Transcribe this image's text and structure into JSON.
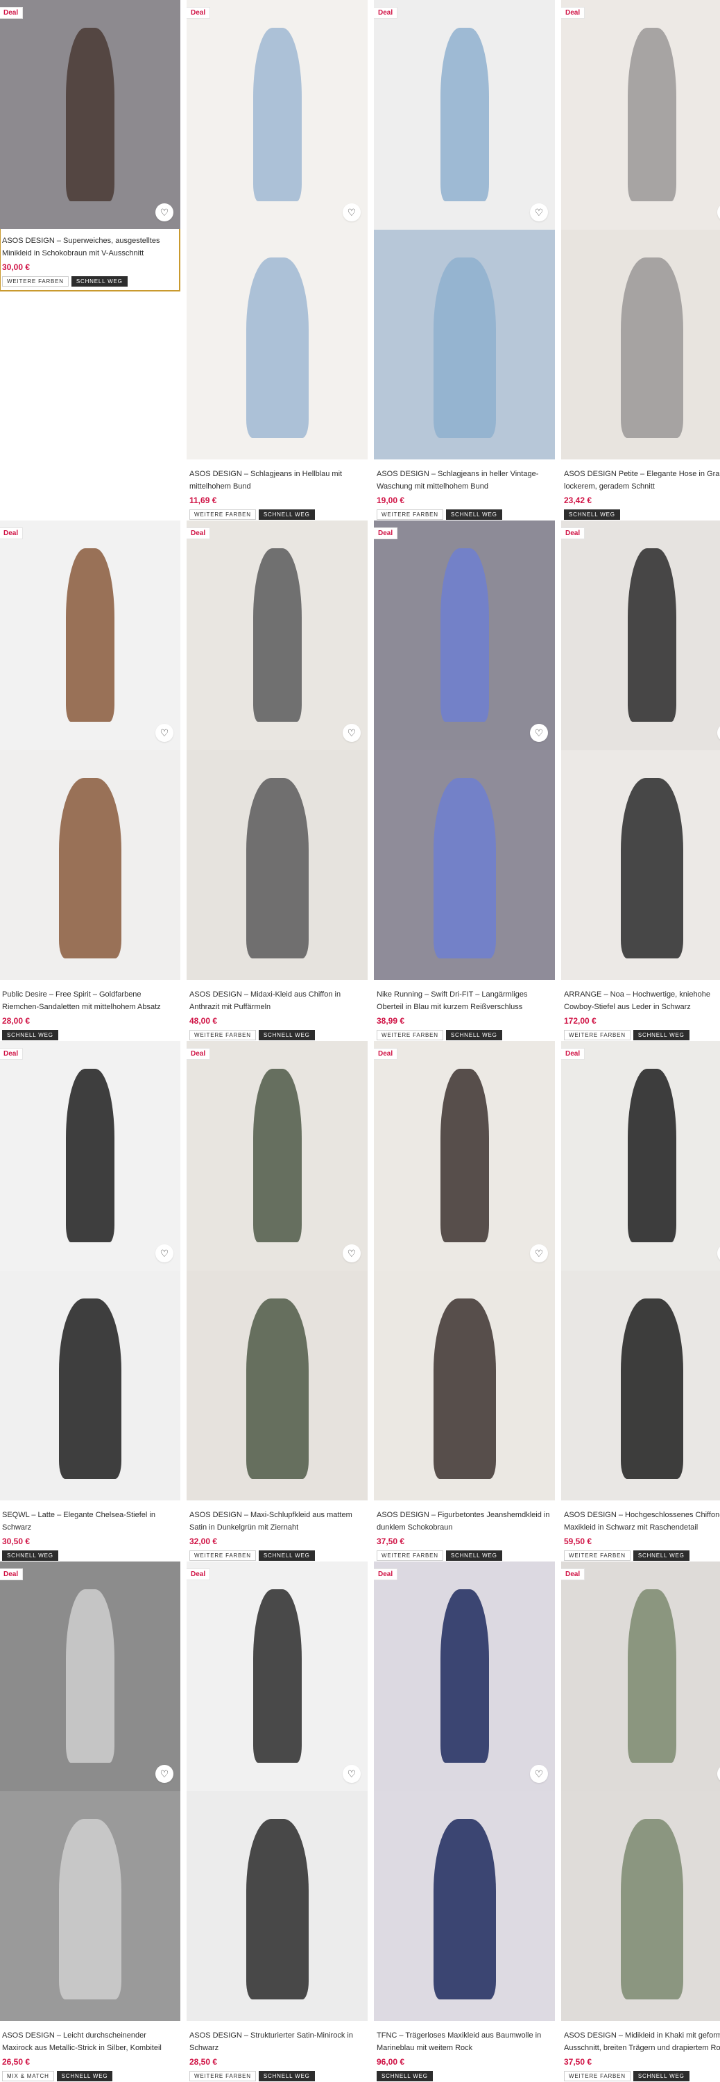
{
  "labels": {
    "deal": "Deal",
    "more_colors": "Weitere Farben",
    "quick": "Schnell weg",
    "mix": "Mix & Match"
  },
  "colors": {
    "price": "#d01345",
    "selected_outline": "#c99a2e"
  },
  "products": [
    {
      "name": "ASOS DESIGN – Superweiches, ausgestelltes Minikleid in Schokobraun mit V-Ausschnitt",
      "price": "30,00 €",
      "tags": [
        "more_colors",
        "quick"
      ],
      "selected": true,
      "bg_top": "#8d8a8f",
      "bg_bottom": "#ffffff",
      "fig": "#4a3a35",
      "single": true
    },
    {
      "name": "ASOS DESIGN – Schlagjeans in Hellblau mit mittelhohem Bund",
      "price": "11,69 €",
      "tags": [
        "more_colors",
        "quick"
      ],
      "bg_top": "#f3f1ee",
      "bg_bottom": "#f3f1ee",
      "fig": "#9fb8d2"
    },
    {
      "name": "ASOS DESIGN – Schlagjeans in heller Vintage-Waschung mit mittelhohem Bund",
      "price": "19,00 €",
      "tags": [
        "more_colors",
        "quick"
      ],
      "bg_top": "#eeeeee",
      "bg_bottom": "#b7c7d8",
      "fig": "#8fb0cf"
    },
    {
      "name": "ASOS DESIGN Petite – Elegante Hose in Grau mit lockerem, geradem Schnitt",
      "price": "23,42 €",
      "tags": [
        "quick"
      ],
      "bg_top": "#ede9e5",
      "bg_bottom": "#e8e4df",
      "fig": "#9a9898"
    },
    {
      "name": "Public Desire – Free Spirit – Goldfarbene Riemchen-Sandaletten mit mittelhohem Absatz",
      "price": "28,00 €",
      "tags": [
        "quick"
      ],
      "bg_top": "#f2f2f2",
      "bg_bottom": "#f0efee",
      "fig": "#8a5a3c"
    },
    {
      "name": "ASOS DESIGN – Midaxi-Kleid aus Chiffon in Anthrazit mit Puffärmeln",
      "price": "48,00 €",
      "tags": [
        "more_colors",
        "quick"
      ],
      "bg_top": "#e9e6e1",
      "bg_bottom": "#e6e3de",
      "fig": "#5a5a5c"
    },
    {
      "name": "Nike Running – Swift Dri-FIT – Langärmliges Oberteil in Blau mit kurzem Reißverschluss",
      "price": "38,99 €",
      "tags": [
        "more_colors",
        "quick"
      ],
      "bg_top": "#8d8b97",
      "bg_bottom": "#8f8c99",
      "fig": "#6e7fd0"
    },
    {
      "name": "ARRANGE – Noa – Hochwertige, kniehohe Cowboy-Stiefel aus Leder in Schwarz",
      "price": "172,00 €",
      "tags": [
        "more_colors",
        "quick"
      ],
      "bg_top": "#e6e3e0",
      "bg_bottom": "#ece9e6",
      "fig": "#2a2a2a"
    },
    {
      "name": "SEQWL – Latte – Elegante Chelsea-Stiefel in Schwarz",
      "price": "30,50 €",
      "tags": [
        "quick"
      ],
      "bg_top": "#f2f2f2",
      "bg_bottom": "#f0f0f0",
      "fig": "#1e1e1e"
    },
    {
      "name": "ASOS DESIGN – Maxi-Schlupfkleid aus mattem Satin in Dunkelgrün mit Ziernaht",
      "price": "32,00 €",
      "tags": [
        "more_colors",
        "quick"
      ],
      "bg_top": "#e8e5e0",
      "bg_bottom": "#e6e2dd",
      "fig": "#4f5a48"
    },
    {
      "name": "ASOS DESIGN – Figurbetontes Jeanshemdkleid in dunklem Schokobraun",
      "price": "37,50 €",
      "tags": [
        "more_colors",
        "quick"
      ],
      "bg_top": "#ece9e4",
      "bg_bottom": "#ebe8e3",
      "fig": "#3d3230"
    },
    {
      "name": "ASOS DESIGN – Hochgeschlossenes Chiffon-Maxikleid in Schwarz mit Raschendetail",
      "price": "59,50 €",
      "tags": [
        "more_colors",
        "quick"
      ],
      "bg_top": "#ecebe8",
      "bg_bottom": "#e9e7e4",
      "fig": "#1f1f1f"
    },
    {
      "name": "ASOS DESIGN – Leicht durchscheinender Maxirock aus Metallic-Strick in Silber, Kombiteil",
      "price": "26,50 €",
      "tags": [
        "mix",
        "quick"
      ],
      "bg_top": "#8c8c8c",
      "bg_bottom": "#9a9a9a",
      "fig": "#cfcfcf"
    },
    {
      "name": "ASOS DESIGN – Strukturierter Satin-Minirock in Schwarz",
      "price": "28,50 €",
      "tags": [
        "more_colors",
        "quick"
      ],
      "bg_top": "#f1f1f1",
      "bg_bottom": "#ececec",
      "fig": "#2b2b2b"
    },
    {
      "name": "TFNC – Trägerloses Maxikleid aus Baumwolle in Marineblau mit weitem Rock",
      "price": "96,00 €",
      "tags": [
        "quick"
      ],
      "bg_top": "#dcd9e1",
      "bg_bottom": "#dddae2",
      "fig": "#1e2a5e"
    },
    {
      "name": "ASOS DESIGN – Midikleid in Khaki mit geformtem Ausschnitt, breiten Trägern und drapiertem Rock",
      "price": "37,50 €",
      "tags": [
        "more_colors",
        "quick"
      ],
      "bg_top": "#dedbd8",
      "bg_bottom": "#dfdcd9",
      "fig": "#7d8a70"
    }
  ]
}
